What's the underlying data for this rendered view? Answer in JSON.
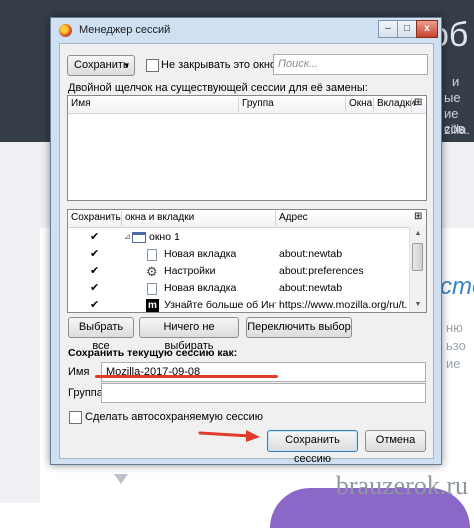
{
  "background": {
    "heading_fragment": "об",
    "right_fragments": [
      "и",
      "ые",
      "ие сов",
      "zilla."
    ],
    "blue_fragment": "сте",
    "lower_fragments": [
      "ню",
      "ьзо",
      "ие"
    ],
    "watermark": "brauzerok.ru"
  },
  "window": {
    "title": "Менеджер сессий",
    "buttons": {
      "minimize": "–",
      "maximize": "□",
      "close": "x"
    }
  },
  "toolbar": {
    "save_dropdown_label": "Сохранить",
    "dropdown_arrow": "▾",
    "keep_open_label": "Не закрывать это окно",
    "search_placeholder": "Поиск..."
  },
  "sessions": {
    "instruction": "Двойной щелчок на существующей сессии для её замены:",
    "columns": [
      "Имя",
      "Группа",
      "Окна",
      "Вкладки"
    ]
  },
  "tabs_list": {
    "columns": [
      "Сохранить",
      "окна и вкладки",
      "Адрес"
    ],
    "rows": [
      {
        "check": "✔",
        "expander": "⊿",
        "title": "окно 1",
        "address": "",
        "icon": "window-icon"
      },
      {
        "check": "✔",
        "title": "Новая вкладка",
        "address": "about:newtab",
        "icon": "tab-icon"
      },
      {
        "check": "✔",
        "title": "Настройки",
        "address": "about:preferences",
        "icon": "gear-icon"
      },
      {
        "check": "✔",
        "title": "Новая вкладка",
        "address": "about:newtab",
        "icon": "tab-icon"
      },
      {
        "check": "✔",
        "title": "Узнайте больше об Инте...",
        "address": "https://www.mozilla.org/ru/t...",
        "icon": "mozilla-icon"
      }
    ]
  },
  "selection_buttons": {
    "select_all": "Выбрать все",
    "select_none": "Ничего не выбирать",
    "toggle": "Переключить выбор"
  },
  "save_form": {
    "heading": "Сохранить текущую сессию как:",
    "name_label": "Имя",
    "name_value": "Mozilla-2017-09-08",
    "group_label": "Группа",
    "group_value": "",
    "autosave_label": "Сделать автосохраняемую сессию"
  },
  "footer": {
    "save_button": "Сохранить сессию",
    "cancel_button": "Отмена"
  },
  "colors": {
    "annotation_red": "#e03c2b",
    "page_dark": "#353d47",
    "window_frame": "#cfe0f3"
  }
}
